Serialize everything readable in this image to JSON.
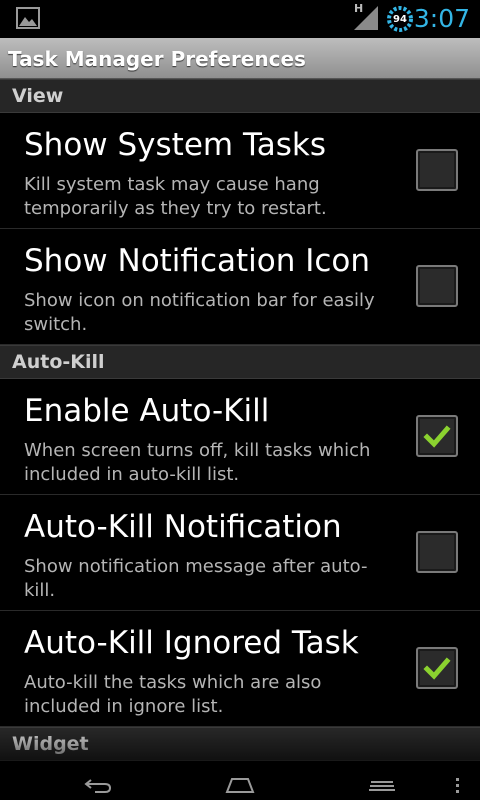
{
  "status_bar": {
    "network_type": "H",
    "battery_level": "94",
    "time": "3:07",
    "icons": [
      "gallery-icon",
      "signal-icon",
      "battery-icon"
    ]
  },
  "title_bar": {
    "title": "Task Manager Preferences"
  },
  "sections": [
    {
      "header": "View",
      "items": [
        {
          "title": "Show System Tasks",
          "summary": "Kill system task may cause hang temporarily as they try to restart.",
          "checked": false
        },
        {
          "title": "Show Notification Icon",
          "summary": "Show icon on notification bar for easily switch.",
          "checked": false
        }
      ]
    },
    {
      "header": "Auto-Kill",
      "items": [
        {
          "title": "Enable Auto-Kill",
          "summary": "When screen turns off, kill tasks which included in auto-kill list.",
          "checked": true
        },
        {
          "title": "Auto-Kill Notification",
          "summary": "Show notification message after auto-kill.",
          "checked": false
        },
        {
          "title": "Auto-Kill Ignored Task",
          "summary": "Auto-kill the tasks which are also included in ignore list.",
          "checked": true
        }
      ]
    },
    {
      "header": "Widget",
      "items": []
    }
  ],
  "nav_bar": {
    "icons": [
      "back-icon",
      "home-icon",
      "recent-apps-icon",
      "menu-icon"
    ]
  },
  "colors": {
    "clock": "#33b5e5",
    "check": "#8bd22f",
    "category_bg": "#262626"
  }
}
